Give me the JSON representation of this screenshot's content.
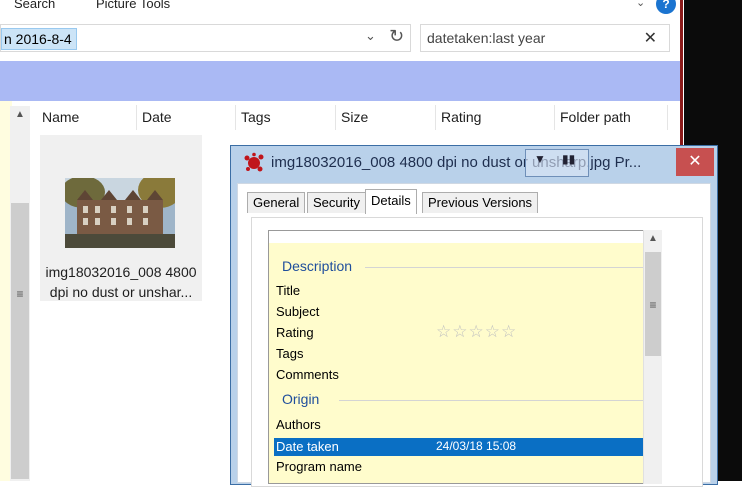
{
  "ribbon": {
    "tabs": [
      "Search",
      "Picture Tools"
    ],
    "help": "?"
  },
  "address": {
    "path": "n 2016-8-4",
    "dropdown_icon": "chevron-down-icon",
    "refresh_icon": "refresh-icon"
  },
  "search": {
    "value": "datetaken:last year",
    "clear": "✕"
  },
  "columns": [
    "Name",
    "Date",
    "Tags",
    "Size",
    "Rating",
    "Folder path"
  ],
  "file": {
    "name": "img18032016_008 4800 dpi no dust or unshar..."
  },
  "dialog": {
    "title": "img18032016_008 4800 dpi no dust or unsharp.jpg Pr...",
    "close": "✕",
    "tabs": [
      "General",
      "Security",
      "Details",
      "Previous Versions"
    ],
    "active_tab": "Details",
    "sections": {
      "description": {
        "title": "Description",
        "fields": [
          "Title",
          "Subject",
          "Rating",
          "Tags",
          "Comments"
        ],
        "rating_stars": "☆☆☆☆☆",
        "rating_value": 0
      },
      "origin": {
        "title": "Origin",
        "authors_label": "Authors",
        "date_taken_label": "Date taken",
        "date_taken_value": "24/03/18 15:08",
        "program_name_label": "Program name"
      }
    }
  },
  "colors": {
    "band": "#aab9f4",
    "selection": "#0a6fc4",
    "dialog_frame": "#b9d1ea",
    "close_button": "#c75050",
    "properties_bg": "#fffccc"
  }
}
